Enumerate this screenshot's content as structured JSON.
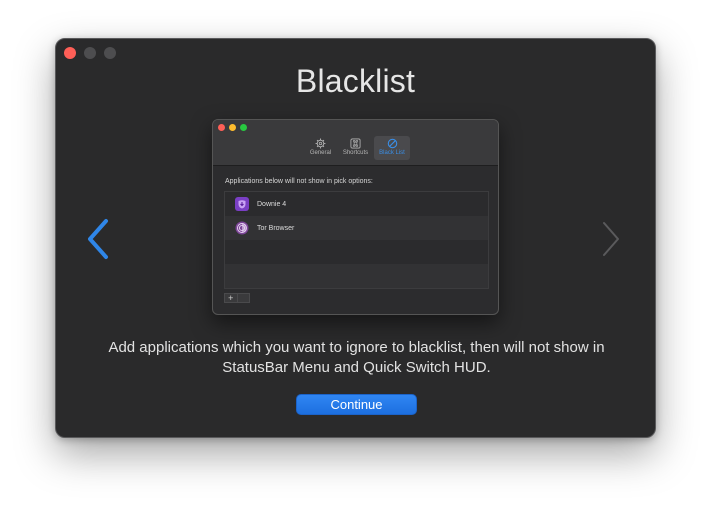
{
  "window": {
    "title": "Blacklist",
    "description": "Add applications which you want to ignore to blacklist, then will not show in StatusBar Menu and Quick Switch HUD.",
    "continue_label": "Continue"
  },
  "preview": {
    "tabs": [
      {
        "label": "General",
        "icon": "gear-icon",
        "active": false
      },
      {
        "label": "Shortcuts",
        "icon": "command-icon",
        "active": false
      },
      {
        "label": "Black List",
        "icon": "prohibited-icon",
        "active": true
      }
    ],
    "list_description": "Applications below will not show in pick options:",
    "apps": [
      {
        "name": "Downie 4",
        "icon": "downie-icon"
      },
      {
        "name": "Tor Browser",
        "icon": "tor-browser-icon"
      }
    ],
    "add_label": "+"
  },
  "colors": {
    "accent": "#1d6fe0",
    "nav_arrow_active": "#2f86e8",
    "nav_arrow_inactive": "#5a5a5c",
    "window_bg": "#2a2a2b"
  }
}
